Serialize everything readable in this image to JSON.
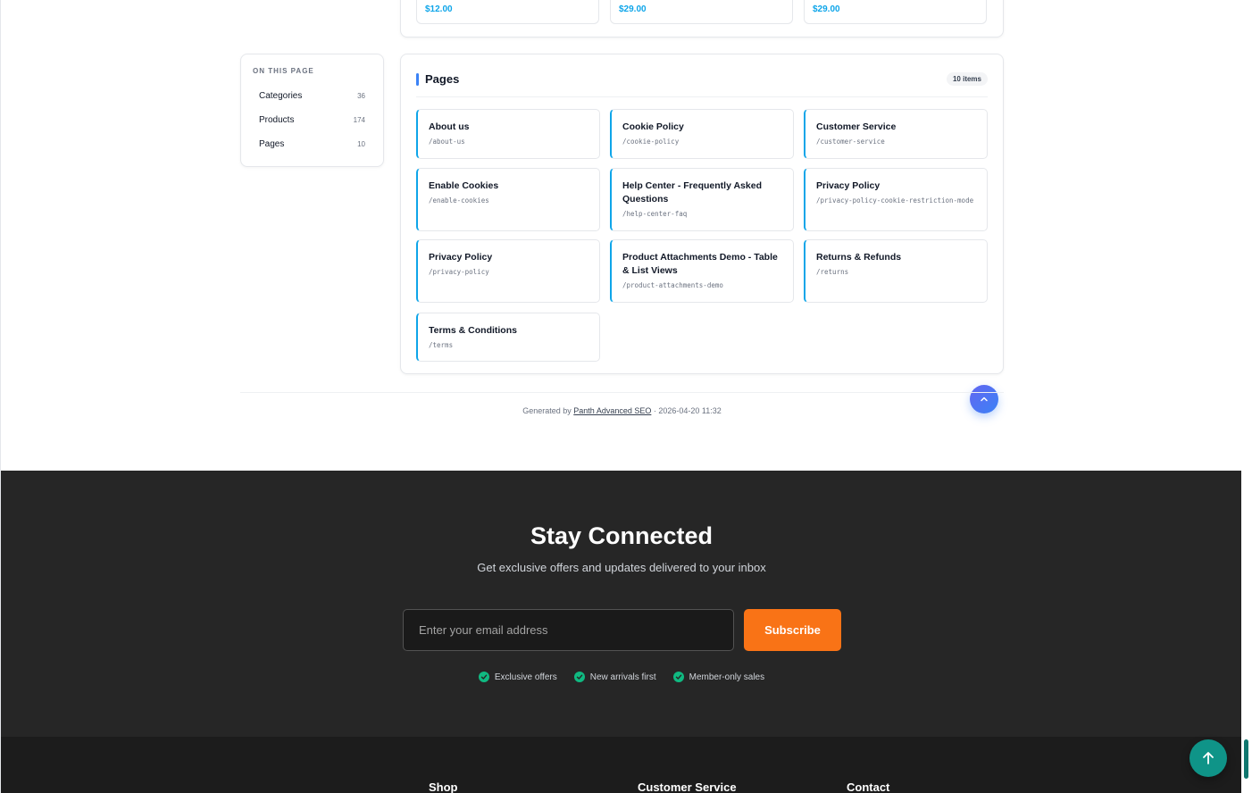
{
  "products_row": {
    "prices": [
      "$12.00",
      "$29.00",
      "$29.00"
    ]
  },
  "toc": {
    "title": "ON THIS PAGE",
    "items": [
      {
        "label": "Categories",
        "count": "36"
      },
      {
        "label": "Products",
        "count": "174"
      },
      {
        "label": "Pages",
        "count": "10"
      }
    ]
  },
  "pages": {
    "title": "Pages",
    "badge": "10 items",
    "items": [
      {
        "title": "About us",
        "path": "/about-us"
      },
      {
        "title": "Cookie Policy",
        "path": "/cookie-policy"
      },
      {
        "title": "Customer Service",
        "path": "/customer-service"
      },
      {
        "title": "Enable Cookies",
        "path": "/enable-cookies"
      },
      {
        "title": "Help Center - Frequently Asked Questions",
        "path": "/help-center-faq"
      },
      {
        "title": "Privacy Policy",
        "path": "/privacy-policy-cookie-restriction-mode"
      },
      {
        "title": "Privacy Policy",
        "path": "/privacy-policy"
      },
      {
        "title": "Product Attachments Demo - Table & List Views",
        "path": "/product-attachments-demo"
      },
      {
        "title": "Returns & Refunds",
        "path": "/returns"
      },
      {
        "title": "Terms & Conditions",
        "path": "/terms"
      }
    ]
  },
  "generated": {
    "prefix": "Generated by",
    "link": "Panth Advanced SEO",
    "suffix": "· 2026-04-20 11:32"
  },
  "newsletter": {
    "title": "Stay Connected",
    "subtitle": "Get exclusive offers and updates delivered to your inbox",
    "placeholder": "Enter your email address",
    "button": "Subscribe",
    "features": [
      "Exclusive offers",
      "New arrivals first",
      "Member-only sales"
    ]
  },
  "footer": {
    "columns": [
      "Shop",
      "Customer Service",
      "Contact"
    ]
  },
  "colors": {
    "accent": "#0ea5e9",
    "subscribe": "#f97316",
    "fab": "#0f9488",
    "newsletter_bg": "#262626"
  },
  "icons": {
    "scroll_up_small": "chevron-up-icon",
    "fab": "arrow-up-icon",
    "feature": "check-circle-icon"
  }
}
